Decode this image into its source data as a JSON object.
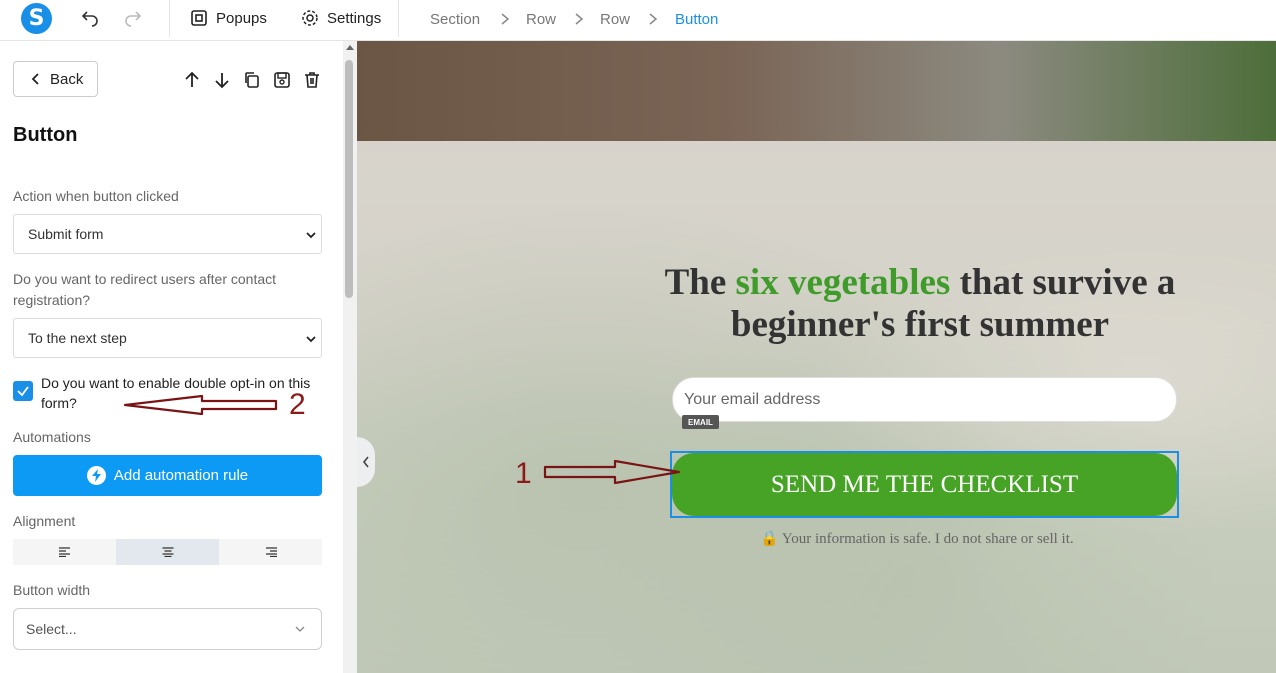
{
  "topbar": {
    "logo_letter": "S",
    "popups_label": "Popups",
    "settings_label": "Settings",
    "breadcrumb": [
      "Section",
      "Row",
      "Row",
      "Button"
    ]
  },
  "sidebar": {
    "back_label": "Back",
    "title": "Button",
    "action_label": "Action when button clicked",
    "action_value": "Submit form",
    "redirect_label": "Do you want to redirect users after contact registration?",
    "redirect_value": "To the next step",
    "double_optin_label": "Do you want to enable double opt-in on this form?",
    "double_optin_checked": true,
    "automations_label": "Automations",
    "add_automation_label": "Add automation rule",
    "alignment_label": "Alignment",
    "alignment_selected": "center",
    "button_width_label": "Button width",
    "button_width_placeholder": "Select..."
  },
  "canvas": {
    "headline_pre": "The ",
    "headline_highlight": "six vegetables",
    "headline_post": " that survive a beginner's first summer",
    "email_placeholder": "Your email address",
    "email_badge": "EMAIL",
    "cta_label": "SEND ME THE CHECKLIST",
    "safe_note": "🔒 Your information is safe. I do not share or sell it."
  },
  "annotations": {
    "arrow_1": "1",
    "arrow_2": "2"
  },
  "colors": {
    "accent": "#1a8fe8",
    "cta_green": "#47a325",
    "headline_green": "#3f9c2b",
    "annotation": "#8b1a1a"
  }
}
